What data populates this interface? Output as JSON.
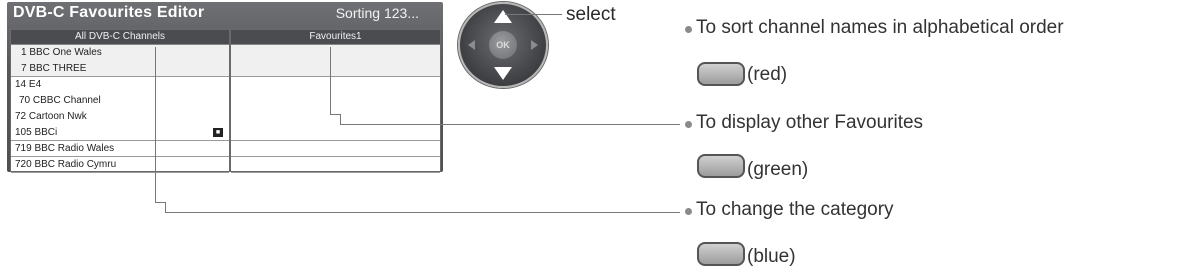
{
  "editor": {
    "title": "DVB-C Favourites Editor",
    "mode": "Sorting 123...",
    "left_list": {
      "header": "All DVB-C Channels",
      "rows": [
        {
          "num": "1",
          "name": "BBC One Wales",
          "selected": true
        },
        {
          "num": "7",
          "name": "BBC THREE",
          "selected": true
        },
        {
          "num": "14",
          "name": "E4"
        },
        {
          "num": "70",
          "name": "CBBC Channel"
        },
        {
          "num": "72",
          "name": "Cartoon Nwk"
        },
        {
          "num": "105",
          "name": "BBCi",
          "icon": "locked-channel-icon"
        },
        {
          "num": "719",
          "name": "BBC Radio Wales"
        },
        {
          "num": "720",
          "name": "BBC Radio Cymru"
        }
      ]
    },
    "right_list": {
      "header": "Favourites1"
    }
  },
  "dpad": {
    "ok_label": "OK",
    "select_label": "select"
  },
  "instructions": [
    {
      "text": "To sort channel names in alphabetical order",
      "key_label": "(red)"
    },
    {
      "text": "To display other Favourites",
      "key_label": "(green)"
    },
    {
      "text": "To change the category",
      "key_label": "(blue)"
    }
  ],
  "icons": [
    "lock-icon",
    "up-arrow-icon",
    "down-arrow-icon",
    "left-arrow-icon",
    "right-arrow-icon",
    "bullet-icon"
  ]
}
